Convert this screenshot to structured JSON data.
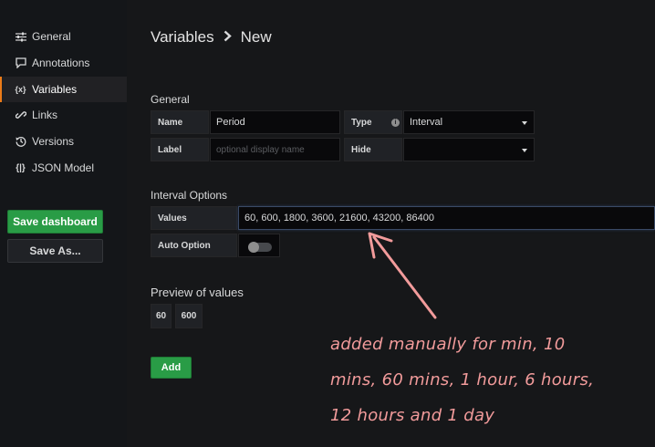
{
  "sidebar": {
    "items": [
      {
        "label": "General",
        "icon": "sliders-icon"
      },
      {
        "label": "Annotations",
        "icon": "comment-icon"
      },
      {
        "label": "Variables",
        "icon": "variable-braces-icon"
      },
      {
        "label": "Links",
        "icon": "link-icon"
      },
      {
        "label": "Versions",
        "icon": "history-icon"
      },
      {
        "label": "JSON Model",
        "icon": "code-braces-icon"
      }
    ],
    "active": "Variables",
    "save_dashboard": "Save dashboard",
    "save_as": "Save As..."
  },
  "breadcrumb": {
    "parent": "Variables",
    "current": "New"
  },
  "general": {
    "heading": "General",
    "name_label": "Name",
    "name_value": "Period",
    "type_label": "Type",
    "type_value": "Interval",
    "label_label": "Label",
    "label_placeholder": "optional display name",
    "hide_label": "Hide",
    "hide_value": ""
  },
  "interval_options": {
    "heading": "Interval Options",
    "values_label": "Values",
    "values_value": "60, 600, 1800, 3600, 21600, 43200, 86400",
    "auto_option_label": "Auto Option",
    "auto_option_enabled": false
  },
  "preview": {
    "heading": "Preview of values",
    "values": [
      "60",
      "600"
    ]
  },
  "add_button": "Add",
  "annotation": {
    "lines": [
      "added manually for min, 10",
      "mins, 60 mins, 1 hour, 6 hours,",
      "12 hours and 1 day"
    ],
    "color": "#f29b9b"
  },
  "colors": {
    "accent_green": "#299c46",
    "active_border": "#eb7b18"
  }
}
